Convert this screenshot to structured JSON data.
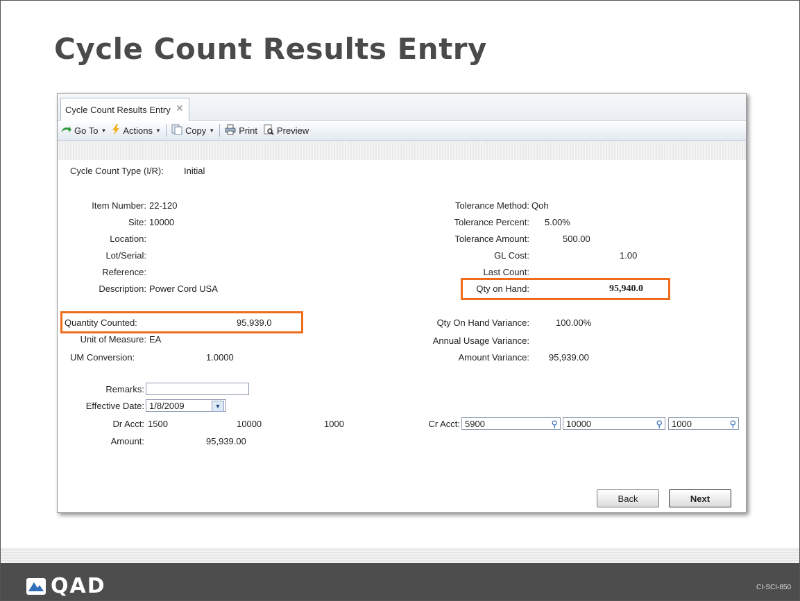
{
  "slide": {
    "title": "Cycle Count Results Entry",
    "footer_code": "CI-SCI-850",
    "logo_text": "QAD"
  },
  "tab": {
    "label": "Cycle Count Results Entry"
  },
  "toolbar": {
    "goto": "Go To",
    "actions": "Actions",
    "copy": "Copy",
    "print": "Print",
    "preview": "Preview"
  },
  "form": {
    "cycle_count_type_label": "Cycle Count Type (I/R):",
    "cycle_count_type_value": "Initial",
    "item_number_label": "Item Number:",
    "item_number_value": "22-120",
    "site_label": "Site:",
    "site_value": "10000",
    "location_label": "Location:",
    "lot_serial_label": "Lot/Serial:",
    "reference_label": "Reference:",
    "description_label": "Description:",
    "description_value": "Power Cord USA",
    "quantity_counted_label": "Quantity Counted:",
    "quantity_counted_value": "95,939.0",
    "uom_label": "Unit of Measure:",
    "uom_value": "EA",
    "um_conversion_label": "UM Conversion:",
    "um_conversion_value": "1.0000",
    "remarks_label": "Remarks:",
    "remarks_value": "",
    "effective_date_label": "Effective Date:",
    "effective_date_value": "1/8/2009",
    "dr_acct_label": "Dr Acct:",
    "dr_acct_value": "1500",
    "dr_sub_value": "10000",
    "dr_cc_value": "1000",
    "amount_label": "Amount:",
    "amount_value": "95,939.00",
    "tolerance_method_label": "Tolerance Method:",
    "tolerance_method_value": "Qoh",
    "tolerance_percent_label": "Tolerance Percent:",
    "tolerance_percent_value": "5.00%",
    "tolerance_amount_label": "Tolerance Amount:",
    "tolerance_amount_value": "500.00",
    "gl_cost_label": "GL Cost:",
    "gl_cost_value": "1.00",
    "last_count_label": "Last Count:",
    "qty_on_hand_label": "Qty on Hand:",
    "qty_on_hand_value": "95,940.0",
    "qty_on_hand_variance_label": "Qty On Hand Variance:",
    "qty_on_hand_variance_value": "100.00%",
    "annual_usage_variance_label": "Annual Usage Variance:",
    "amount_variance_label": "Amount Variance:",
    "amount_variance_value": "95,939.00",
    "cr_acct_label": "Cr Acct:",
    "cr_acct_value": "5900",
    "cr_sub_value": "10000",
    "cr_cc_value": "1000"
  },
  "buttons": {
    "back": "Back",
    "next": "Next"
  },
  "colors": {
    "highlight": "#ef6c1a",
    "footer": "#4d4d4d",
    "title": "#4a4a4a"
  }
}
